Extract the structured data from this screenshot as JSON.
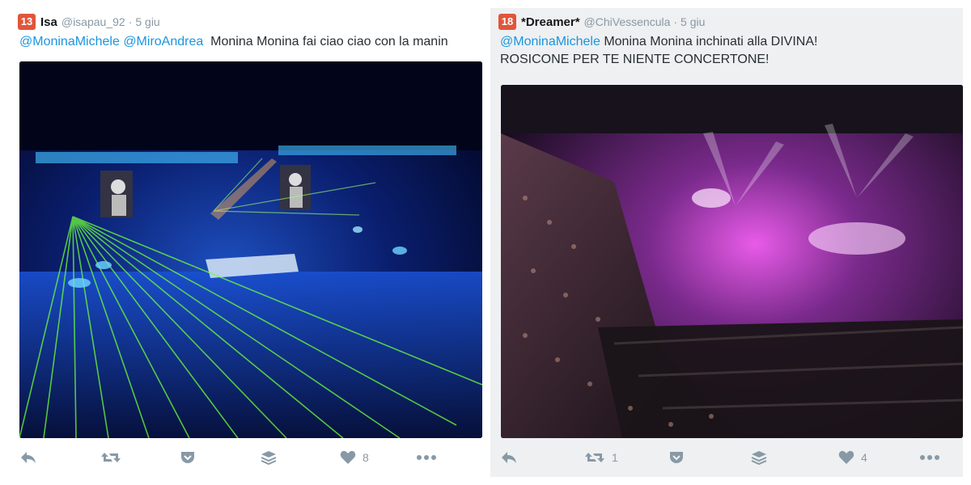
{
  "tweets": [
    {
      "rank": "13",
      "badge_color": "#e0553b",
      "display_name": "Isa",
      "handle": "@isapau_92",
      "separator": "·",
      "time": "5 giu",
      "mentions": [
        "@MoninaMichele",
        "@MiroAndrea"
      ],
      "text": "Monina Monina fai ciao ciao con la manin",
      "photo": "concert-arena-green-lasers",
      "actions": {
        "reply": "reply-icon",
        "retweet": "retweet-icon",
        "pocket": "pocket-icon",
        "buffer": "buffer-icon",
        "like": "heart-icon",
        "more": "more-icon"
      },
      "like_count": "8",
      "retweet_count": ""
    },
    {
      "rank": "18",
      "badge_color": "#e0553b",
      "display_name": "*Dreamer*",
      "handle": "@ChiVessencula",
      "separator": "·",
      "time": "5 giu",
      "mentions": [
        "@MoninaMichele"
      ],
      "text_line1": "Monina Monina inchinati alla DIVINA!",
      "text_line2": "ROSICONE PER TE NIENTE CONCERTONE!",
      "photo": "concert-arena-purple-crowd",
      "actions": {
        "reply": "reply-icon",
        "retweet": "retweet-icon",
        "pocket": "pocket-icon",
        "buffer": "buffer-icon",
        "like": "heart-icon",
        "more": "more-icon"
      },
      "retweet_count": "1",
      "like_count": "4"
    }
  ],
  "colors": {
    "mention": "#1b95e0",
    "meta_gray": "#8899a6",
    "right_background": "#eef0f1"
  }
}
